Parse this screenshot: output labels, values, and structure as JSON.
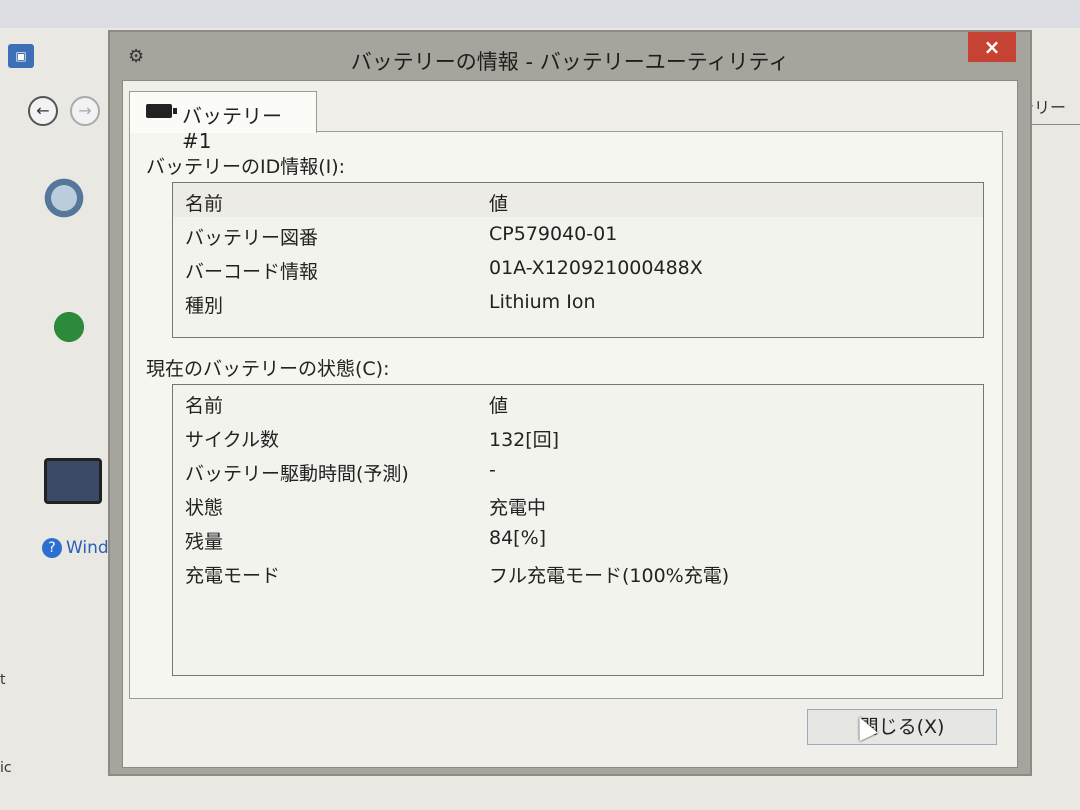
{
  "background": {
    "help_link": "Wind",
    "right_tab_fragment": "テリー",
    "left_fragments": [
      "t",
      "ic"
    ]
  },
  "dialog": {
    "title": "バッテリーの情報 - バッテリーユーティリティ",
    "close_glyph": "×",
    "tab_label": "バッテリー #1",
    "id_section": {
      "label": "バッテリーのID情報(I):",
      "headers": [
        "名前",
        "値"
      ],
      "rows": [
        [
          "バッテリー図番",
          "CP579040-01"
        ],
        [
          "バーコード情報",
          "01A-X120921000488X"
        ],
        [
          "種別",
          "Lithium Ion"
        ]
      ]
    },
    "status_section": {
      "label": "現在のバッテリーの状態(C):",
      "headers": [
        "名前",
        "値"
      ],
      "rows": [
        [
          "サイクル数",
          "132[回]"
        ],
        [
          "バッテリー駆動時間(予測)",
          "-"
        ],
        [
          "状態",
          "充電中"
        ],
        [
          "残量",
          "84[%]"
        ],
        [
          "充電モード",
          "フル充電モード(100%充電)"
        ]
      ]
    },
    "close_button_label": "閉じる(X)"
  },
  "colors": {
    "close_red": "#c64235",
    "dialog_frame": "#a6a49c",
    "panel_bg": "#f6f6f1",
    "help_blue": "#2b5fb8"
  }
}
